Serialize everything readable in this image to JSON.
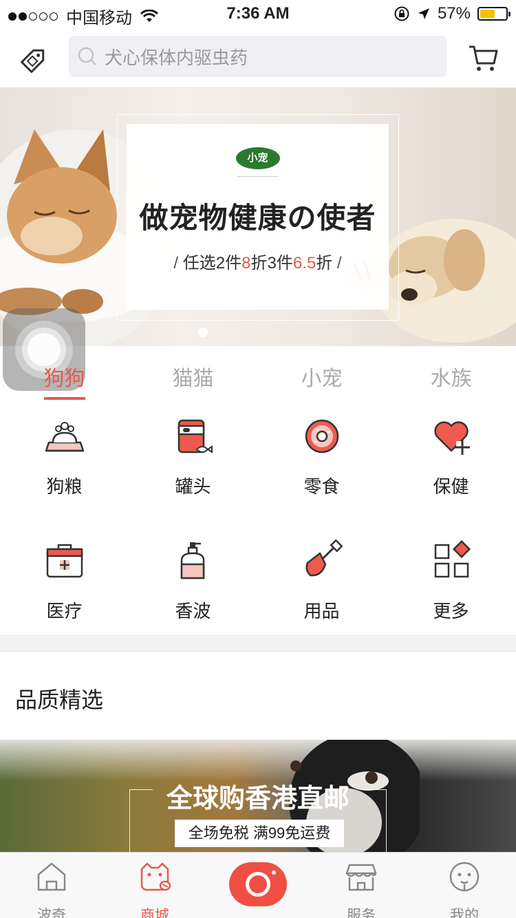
{
  "status_bar": {
    "carrier": "中国移动",
    "time": "7:36 AM",
    "battery": "57%",
    "battery_level": 0.57
  },
  "header": {
    "search_placeholder": "犬心保体内驱虫药"
  },
  "banner": {
    "logo_text": "小宠",
    "slogan": "做宠物健康の使者",
    "promo_a": "任选2件",
    "promo_b": "8",
    "promo_c": "折3件",
    "promo_d": "6.5",
    "promo_e": "折"
  },
  "tabs": [
    {
      "label": "狗狗",
      "active": true
    },
    {
      "label": "猫猫",
      "active": false
    },
    {
      "label": "小宠",
      "active": false
    },
    {
      "label": "水族",
      "active": false
    }
  ],
  "categories": [
    {
      "label": "狗粮",
      "icon": "dog-food-icon"
    },
    {
      "label": "罐头",
      "icon": "can-icon"
    },
    {
      "label": "零食",
      "icon": "donut-icon"
    },
    {
      "label": "保健",
      "icon": "heart-plus-icon"
    },
    {
      "label": "医疗",
      "icon": "medical-kit-icon"
    },
    {
      "label": "香波",
      "icon": "shampoo-icon"
    },
    {
      "label": "用品",
      "icon": "shovel-icon"
    },
    {
      "label": "更多",
      "icon": "more-grid-icon"
    }
  ],
  "section": {
    "title": "品质精选"
  },
  "promo": {
    "title": "全球购香港直邮",
    "subtitle": "全场免税 满99免运费"
  },
  "tabbar": [
    {
      "label": "波奇",
      "active": false
    },
    {
      "label": "商城",
      "active": true
    },
    {
      "label": "",
      "active": false
    },
    {
      "label": "服务",
      "active": false
    },
    {
      "label": "我的",
      "active": false
    }
  ],
  "colors": {
    "accent": "#e8594f",
    "icon_pink": "#f7c6c0",
    "icon_red": "#ef5a4e"
  }
}
